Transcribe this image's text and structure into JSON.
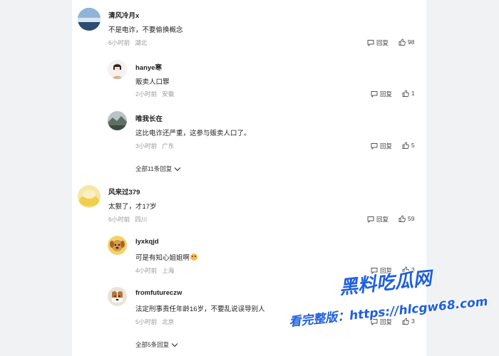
{
  "labels": {
    "reply": "回复",
    "unit_reply": "条回复"
  },
  "comments": [
    {
      "user": "清风冷月x",
      "text": "不是电诈，不要偷换概念",
      "time": "6小时前",
      "location": "湖北",
      "likes": "98",
      "replies": [
        {
          "user": "hanye寒",
          "text": "贩卖人口罪",
          "time": "2小时前",
          "location": "安徽",
          "likes": "1"
        },
        {
          "user": "唯我长在",
          "text": "这比电诈还严重，这参与贩卖人口了。",
          "time": "3小时前",
          "location": "广东",
          "likes": "5"
        }
      ],
      "more": "全部11条回复"
    },
    {
      "user": "风来过379",
      "text": "太狠了，才17岁",
      "time": "6小时前",
      "location": "四川",
      "likes": "59",
      "replies": [
        {
          "user": "lyxkqjd",
          "text": "可是有知心姐姐啊",
          "emoji": "emoji-face",
          "time": "4小时前",
          "location": "上海",
          "likes": "3"
        },
        {
          "user": "fromfutureczw",
          "text": "法定刑事责任年龄16岁，不要乱说误导别人",
          "time": "5小时前",
          "location": "北京",
          "likes": "3"
        }
      ],
      "more": "全部5条回复"
    }
  ],
  "watermark": {
    "title": "黑料吃瓜网",
    "url_line": "看完整版：https://hlcgw68.com"
  },
  "colors": {
    "watermark": "#1f5fe0",
    "meta": "#999999",
    "panel": "#ffffff",
    "background": "#f1f2f4"
  }
}
